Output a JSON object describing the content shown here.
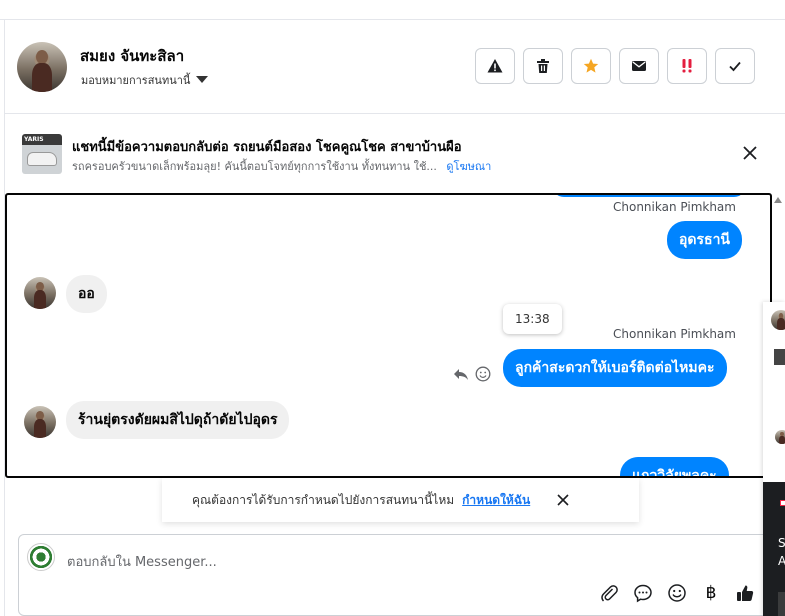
{
  "header": {
    "contact_name": "สมยง จันทะสิลา",
    "assign_label": "มอบหมายการสนทนานี้",
    "actions": [
      {
        "name": "report-button",
        "icon": "warning-icon"
      },
      {
        "name": "delete-button",
        "icon": "trash-icon"
      },
      {
        "name": "star-button",
        "icon": "star-icon",
        "color": "#f5a623"
      },
      {
        "name": "mark-unread-button",
        "icon": "envelope-icon"
      },
      {
        "name": "follow-up-button",
        "icon": "double-exclamation-icon",
        "color": "#e41e3f"
      },
      {
        "name": "mark-done-button",
        "icon": "check-icon"
      }
    ]
  },
  "ad": {
    "thumb_text": "YARIS",
    "title": "แชทนี้มีข้อความตอบกลับต่อ รถยนต์มือสอง โชคคูณโชค สาขาบ้านผือ",
    "description": "รถครอบครัวขนาดเล็กพร้อมลุย! คันนี้ตอบโจทย์ทุกการใช้งาน ทั้งทนทาน ใช้...",
    "link": "ดูโฆษณา"
  },
  "messages": {
    "sender_1": "Chonnikan Pimkham",
    "out_1": "อุดรธานี",
    "in_1": "ออ",
    "time": "13:38",
    "sender_2": "Chonnikan Pimkham",
    "out_2": "ลูกค้าสะดวกให้เบอร์ติดต่อไหมคะ",
    "in_2": "ร้านยุ่ตรงดัยผมสิไปดุถ้าดัยไปอุดร",
    "out_3": "แถววิลัยพลคะ"
  },
  "toast": {
    "text": "คุณต้องการได้รับการกำหนดไปยังการสนทนานี้ไหม",
    "link": "กำหนดให้ฉัน"
  },
  "composer": {
    "placeholder": "ตอบกลับใน Messenger...",
    "tools": [
      "paperclip-icon",
      "chat-bubble-icon",
      "smiley-icon",
      "baht-icon",
      "thumbs-up-icon"
    ],
    "baht_symbol": "฿"
  },
  "right_panel": {
    "text": "S\nA"
  },
  "colors": {
    "accent": "#0084ff",
    "link": "#1877f2",
    "star": "#f5a623",
    "alert": "#e41e3f"
  }
}
